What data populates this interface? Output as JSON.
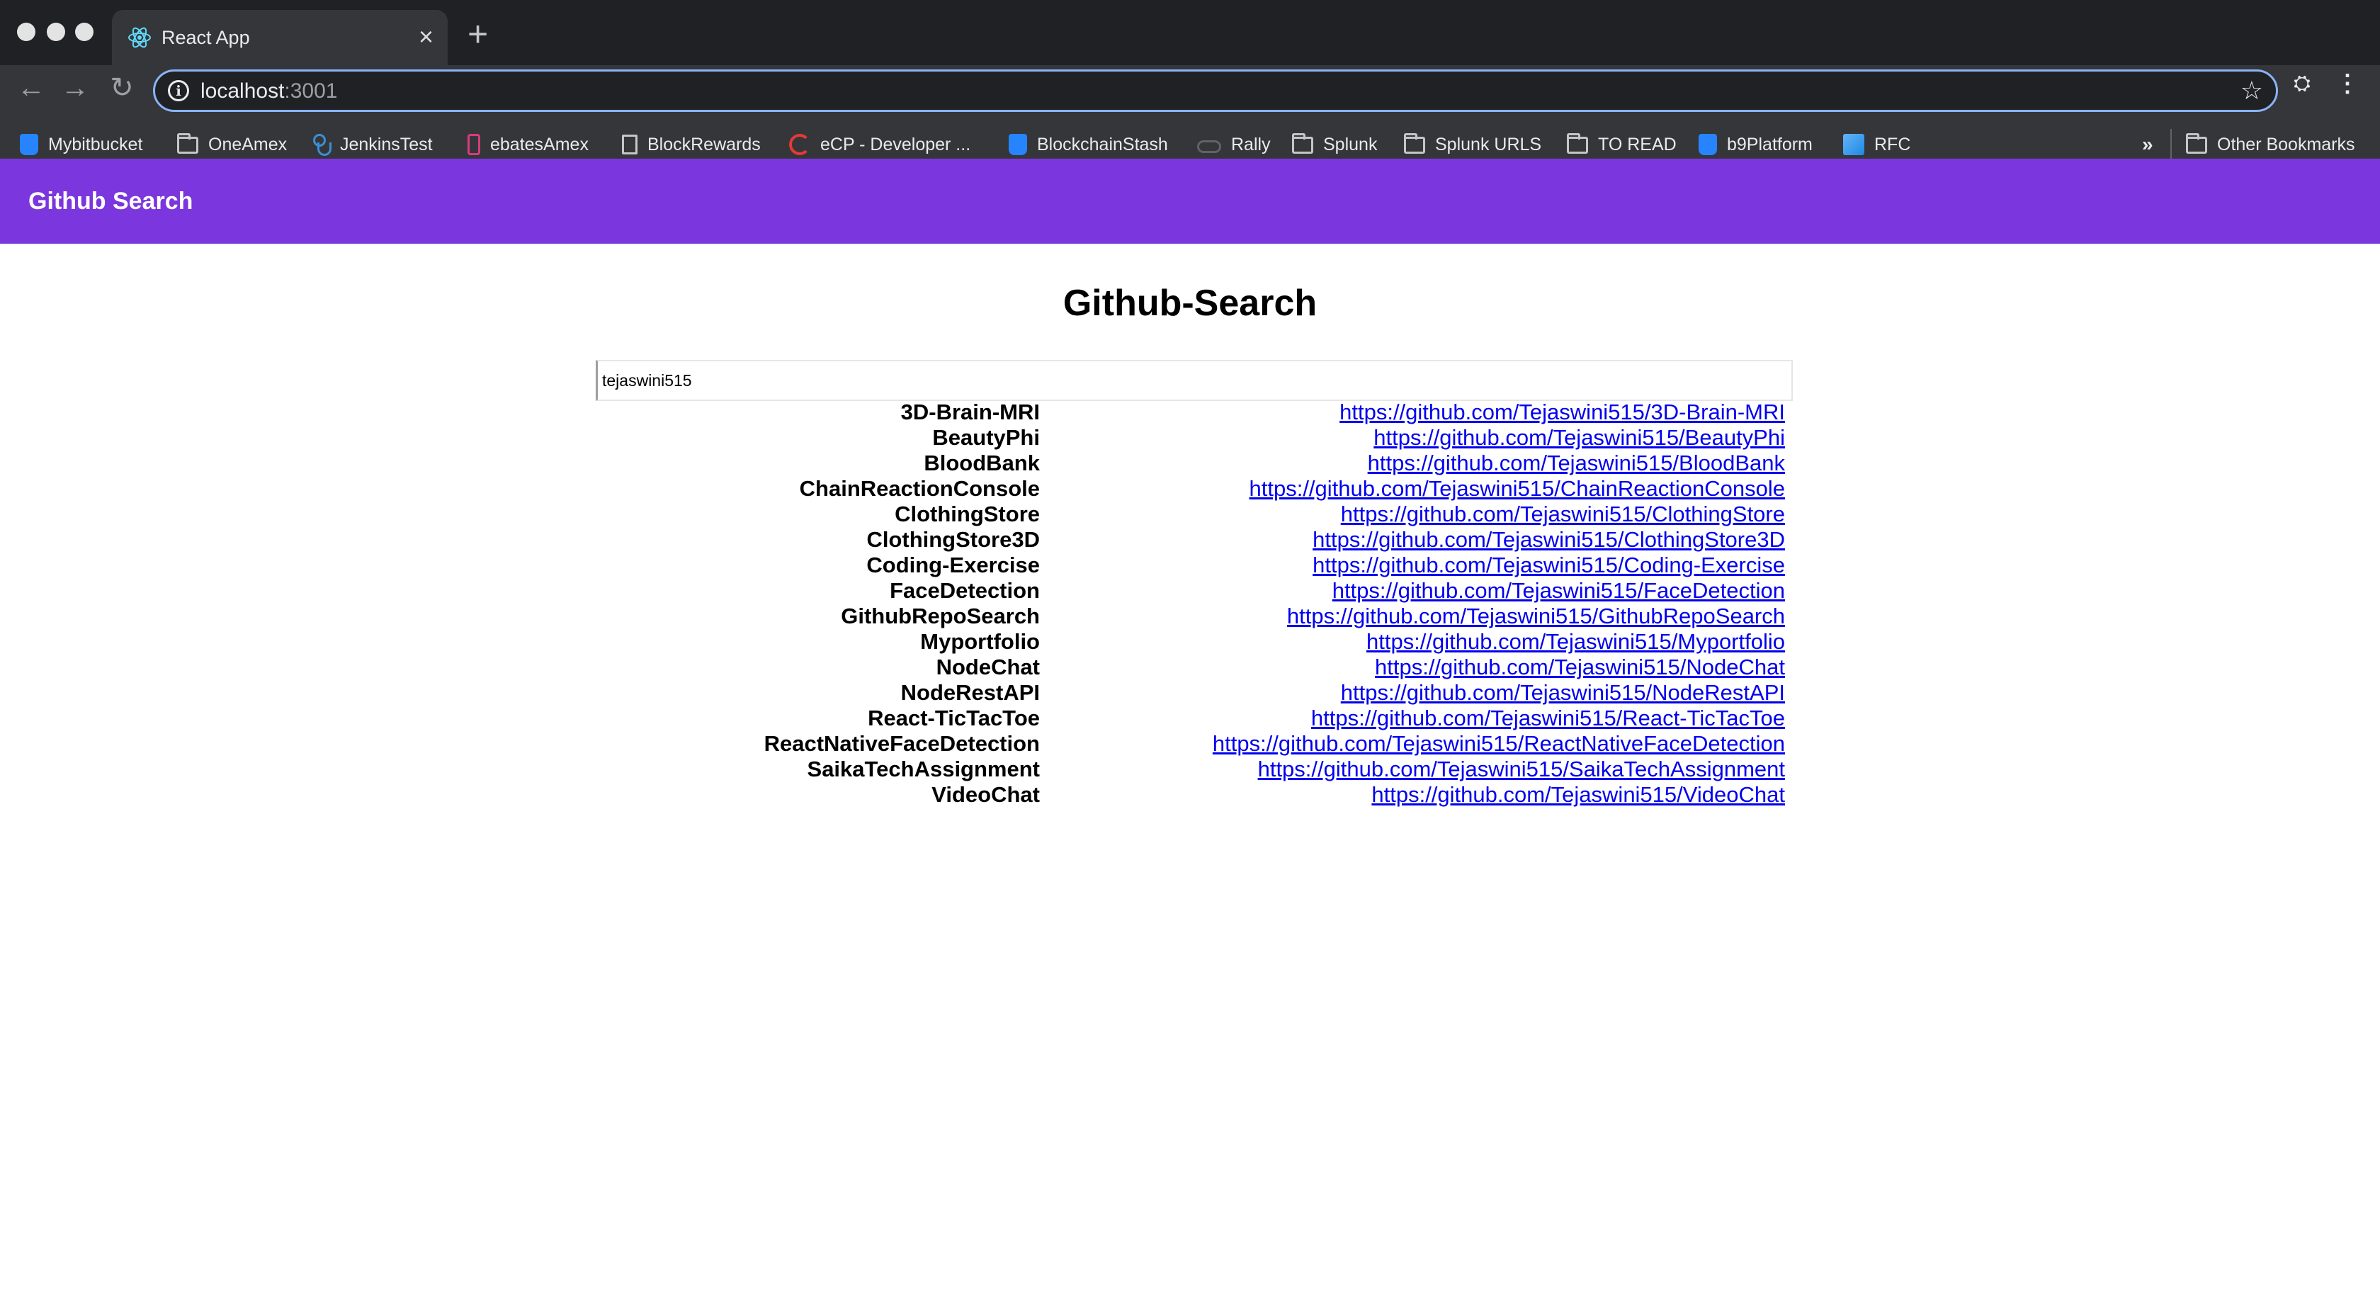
{
  "browser": {
    "tab_title": "React App",
    "url_host": "localhost",
    "url_port": ":3001",
    "bookmarks": [
      {
        "label": "Mybitbucket",
        "icon": "bitbucket-icon"
      },
      {
        "label": "OneAmex",
        "icon": "folder-icon"
      },
      {
        "label": "JenkinsTest",
        "icon": "jenkins-icon"
      },
      {
        "label": "ebatesAmex",
        "icon": "ebates-icon"
      },
      {
        "label": "BlockRewards",
        "icon": "page-icon"
      },
      {
        "label": "eCP - Developer ...",
        "icon": "ecp-icon"
      },
      {
        "label": "BlockchainStash",
        "icon": "bitbucket-icon"
      },
      {
        "label": "Rally",
        "icon": "rally-icon"
      },
      {
        "label": "Splunk",
        "icon": "folder-icon"
      },
      {
        "label": "Splunk URLS",
        "icon": "folder-icon"
      },
      {
        "label": "TO READ",
        "icon": "folder-icon"
      },
      {
        "label": "b9Platform",
        "icon": "bitbucket-icon"
      },
      {
        "label": "RFC",
        "icon": "rfc-icon"
      }
    ],
    "bookmarks_overflow": "»",
    "other_bookmarks": "Other Bookmarks"
  },
  "app": {
    "appbar_title": "Github Search",
    "heading": "Github-Search",
    "search_value": "tejaswini515",
    "repos": [
      {
        "name": "3D-Brain-MRI",
        "url": "https://github.com/Tejaswini515/3D-Brain-MRI"
      },
      {
        "name": "BeautyPhi",
        "url": "https://github.com/Tejaswini515/BeautyPhi"
      },
      {
        "name": "BloodBank",
        "url": "https://github.com/Tejaswini515/BloodBank"
      },
      {
        "name": "ChainReactionConsole",
        "url": "https://github.com/Tejaswini515/ChainReactionConsole"
      },
      {
        "name": "ClothingStore",
        "url": "https://github.com/Tejaswini515/ClothingStore"
      },
      {
        "name": "ClothingStore3D",
        "url": "https://github.com/Tejaswini515/ClothingStore3D"
      },
      {
        "name": "Coding-Exercise",
        "url": "https://github.com/Tejaswini515/Coding-Exercise"
      },
      {
        "name": "FaceDetection",
        "url": "https://github.com/Tejaswini515/FaceDetection"
      },
      {
        "name": "GithubRepoSearch",
        "url": "https://github.com/Tejaswini515/GithubRepoSearch"
      },
      {
        "name": "Myportfolio",
        "url": "https://github.com/Tejaswini515/Myportfolio"
      },
      {
        "name": "NodeChat",
        "url": "https://github.com/Tejaswini515/NodeChat"
      },
      {
        "name": "NodeRestAPI",
        "url": "https://github.com/Tejaswini515/NodeRestAPI"
      },
      {
        "name": "React-TicTacToe",
        "url": "https://github.com/Tejaswini515/React-TicTacToe"
      },
      {
        "name": "ReactNativeFaceDetection",
        "url": "https://github.com/Tejaswini515/ReactNativeFaceDetection"
      },
      {
        "name": "SaikaTechAssignment",
        "url": "https://github.com/Tejaswini515/SaikaTechAssignment"
      },
      {
        "name": "VideoChat",
        "url": "https://github.com/Tejaswini515/VideoChat"
      }
    ]
  },
  "colors": {
    "appbar": "#7b37dd",
    "link": "#0000ee"
  }
}
